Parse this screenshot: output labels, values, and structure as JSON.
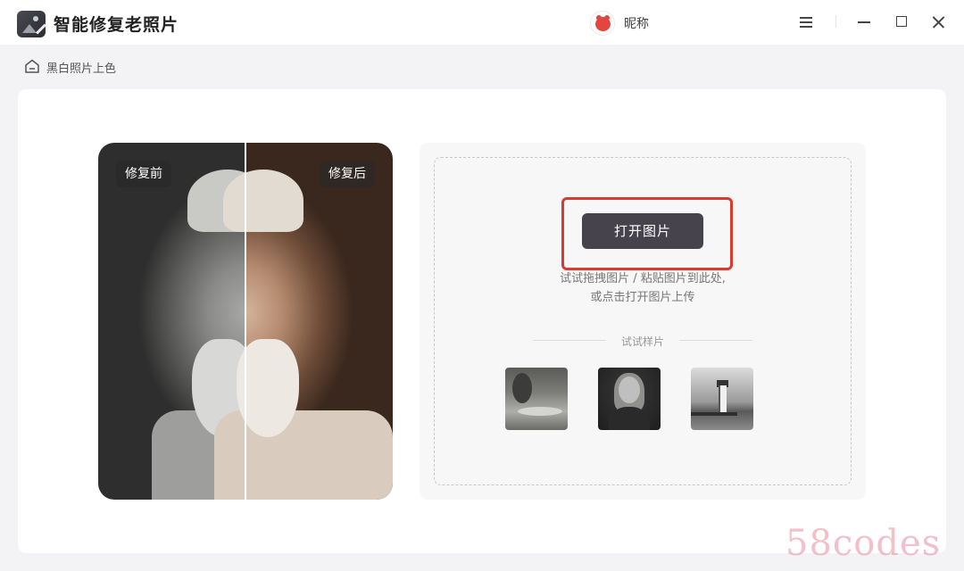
{
  "app": {
    "title": "智能修复老照片",
    "logo_icon": "photo-restore-icon"
  },
  "user": {
    "nickname": "昵称",
    "avatar_icon": "red-creature-avatar-icon"
  },
  "window_controls": {
    "menu_icon": "hamburger-menu-icon",
    "minimize_icon": "minimize-icon",
    "maximize_icon": "maximize-icon",
    "close_icon": "close-icon"
  },
  "breadcrumb": {
    "icon": "home-icon",
    "label": "黑白照片上色"
  },
  "preview": {
    "before_label": "修复前",
    "after_label": "修复后"
  },
  "upload": {
    "open_button": "打开图片",
    "hint_line1": "试试拖拽图片 / 粘贴图片到此处,",
    "hint_line2": "或点击打开图片上传",
    "samples_label": "试试样片",
    "highlight_color": "#d83b30",
    "button_color": "#47434d"
  },
  "samples": [
    {
      "name": "garden-sample"
    },
    {
      "name": "portrait-sample"
    },
    {
      "name": "lighthouse-sample"
    }
  ],
  "watermark": "58codes"
}
